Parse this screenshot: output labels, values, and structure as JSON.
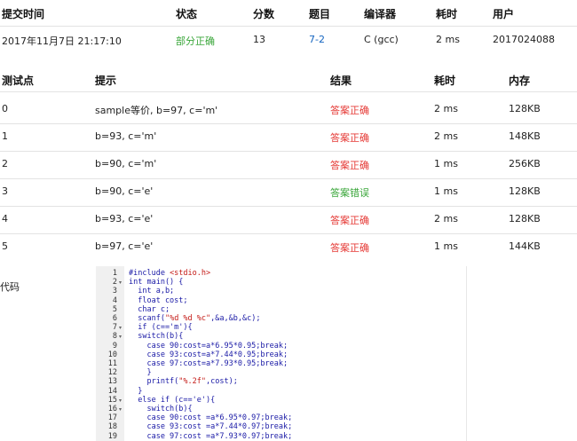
{
  "submission": {
    "headers": [
      "提交时间",
      "状态",
      "分数",
      "题目",
      "编译器",
      "耗时",
      "用户"
    ],
    "row": {
      "time": "2017年11月7日 21:17:10",
      "status": "部分正确",
      "score": "13",
      "problem": "7-2",
      "compiler": "C (gcc)",
      "duration": "2 ms",
      "user": "2017024088"
    }
  },
  "testcases": {
    "headers": [
      "测试点",
      "提示",
      "结果",
      "耗时",
      "内存"
    ],
    "rows": [
      {
        "id": "0",
        "hint": "sample等价, b=97, c='m'",
        "result": "答案正确",
        "time": "2 ms",
        "memory": "128KB"
      },
      {
        "id": "1",
        "hint": "b=93, c='m'",
        "result": "答案正确",
        "time": "2 ms",
        "memory": "148KB"
      },
      {
        "id": "2",
        "hint": "b=90, c='m'",
        "result": "答案正确",
        "time": "1 ms",
        "memory": "256KB"
      },
      {
        "id": "3",
        "hint": "b=90, c='e'",
        "result": "答案错误",
        "time": "1 ms",
        "memory": "128KB"
      },
      {
        "id": "4",
        "hint": "b=93, c='e'",
        "result": "答案正确",
        "time": "2 ms",
        "memory": "128KB"
      },
      {
        "id": "5",
        "hint": "b=97, c='e'",
        "result": "答案正确",
        "time": "1 ms",
        "memory": "144KB"
      }
    ]
  },
  "code_label": "代码",
  "code_lines": [
    {
      "n": "1",
      "text": "#include <stdio.h>"
    },
    {
      "n": "2",
      "text": "int main() {",
      "fold": true
    },
    {
      "n": "3",
      "text": "  int a,b;"
    },
    {
      "n": "4",
      "text": "  float cost;"
    },
    {
      "n": "5",
      "text": "  char c;"
    },
    {
      "n": "6",
      "text": "  scanf(\"%d %d %c\",&a,&b,&c);"
    },
    {
      "n": "7",
      "text": "  if (c=='m'){",
      "fold": true
    },
    {
      "n": "8",
      "text": "  switch(b){",
      "fold": true
    },
    {
      "n": "9",
      "text": "    case 90:cost=a*6.95*0.95;break;"
    },
    {
      "n": "10",
      "text": "    case 93:cost=a*7.44*0.95;break;"
    },
    {
      "n": "11",
      "text": "    case 97:cost=a*7.93*0.95;break;"
    },
    {
      "n": "12",
      "text": "    }"
    },
    {
      "n": "13",
      "text": "    printf(\"%.2f\",cost);"
    },
    {
      "n": "14",
      "text": "  }"
    },
    {
      "n": "15",
      "text": "  else if (c=='e'){",
      "fold": true
    },
    {
      "n": "16",
      "text": "    switch(b){",
      "fold": true
    },
    {
      "n": "17",
      "text": "    case 90:cost =a*6.95*0.97;break;"
    },
    {
      "n": "18",
      "text": "    case 93:cost =a*7.44*0.97;break;"
    },
    {
      "n": "19",
      "text": "    case 97:cost =a*7.93*0.97;break;"
    }
  ],
  "colors": {
    "correct": "#e53935",
    "wrong": "#3aa63a",
    "partial": "#3aa63a",
    "link": "#1565c0"
  }
}
